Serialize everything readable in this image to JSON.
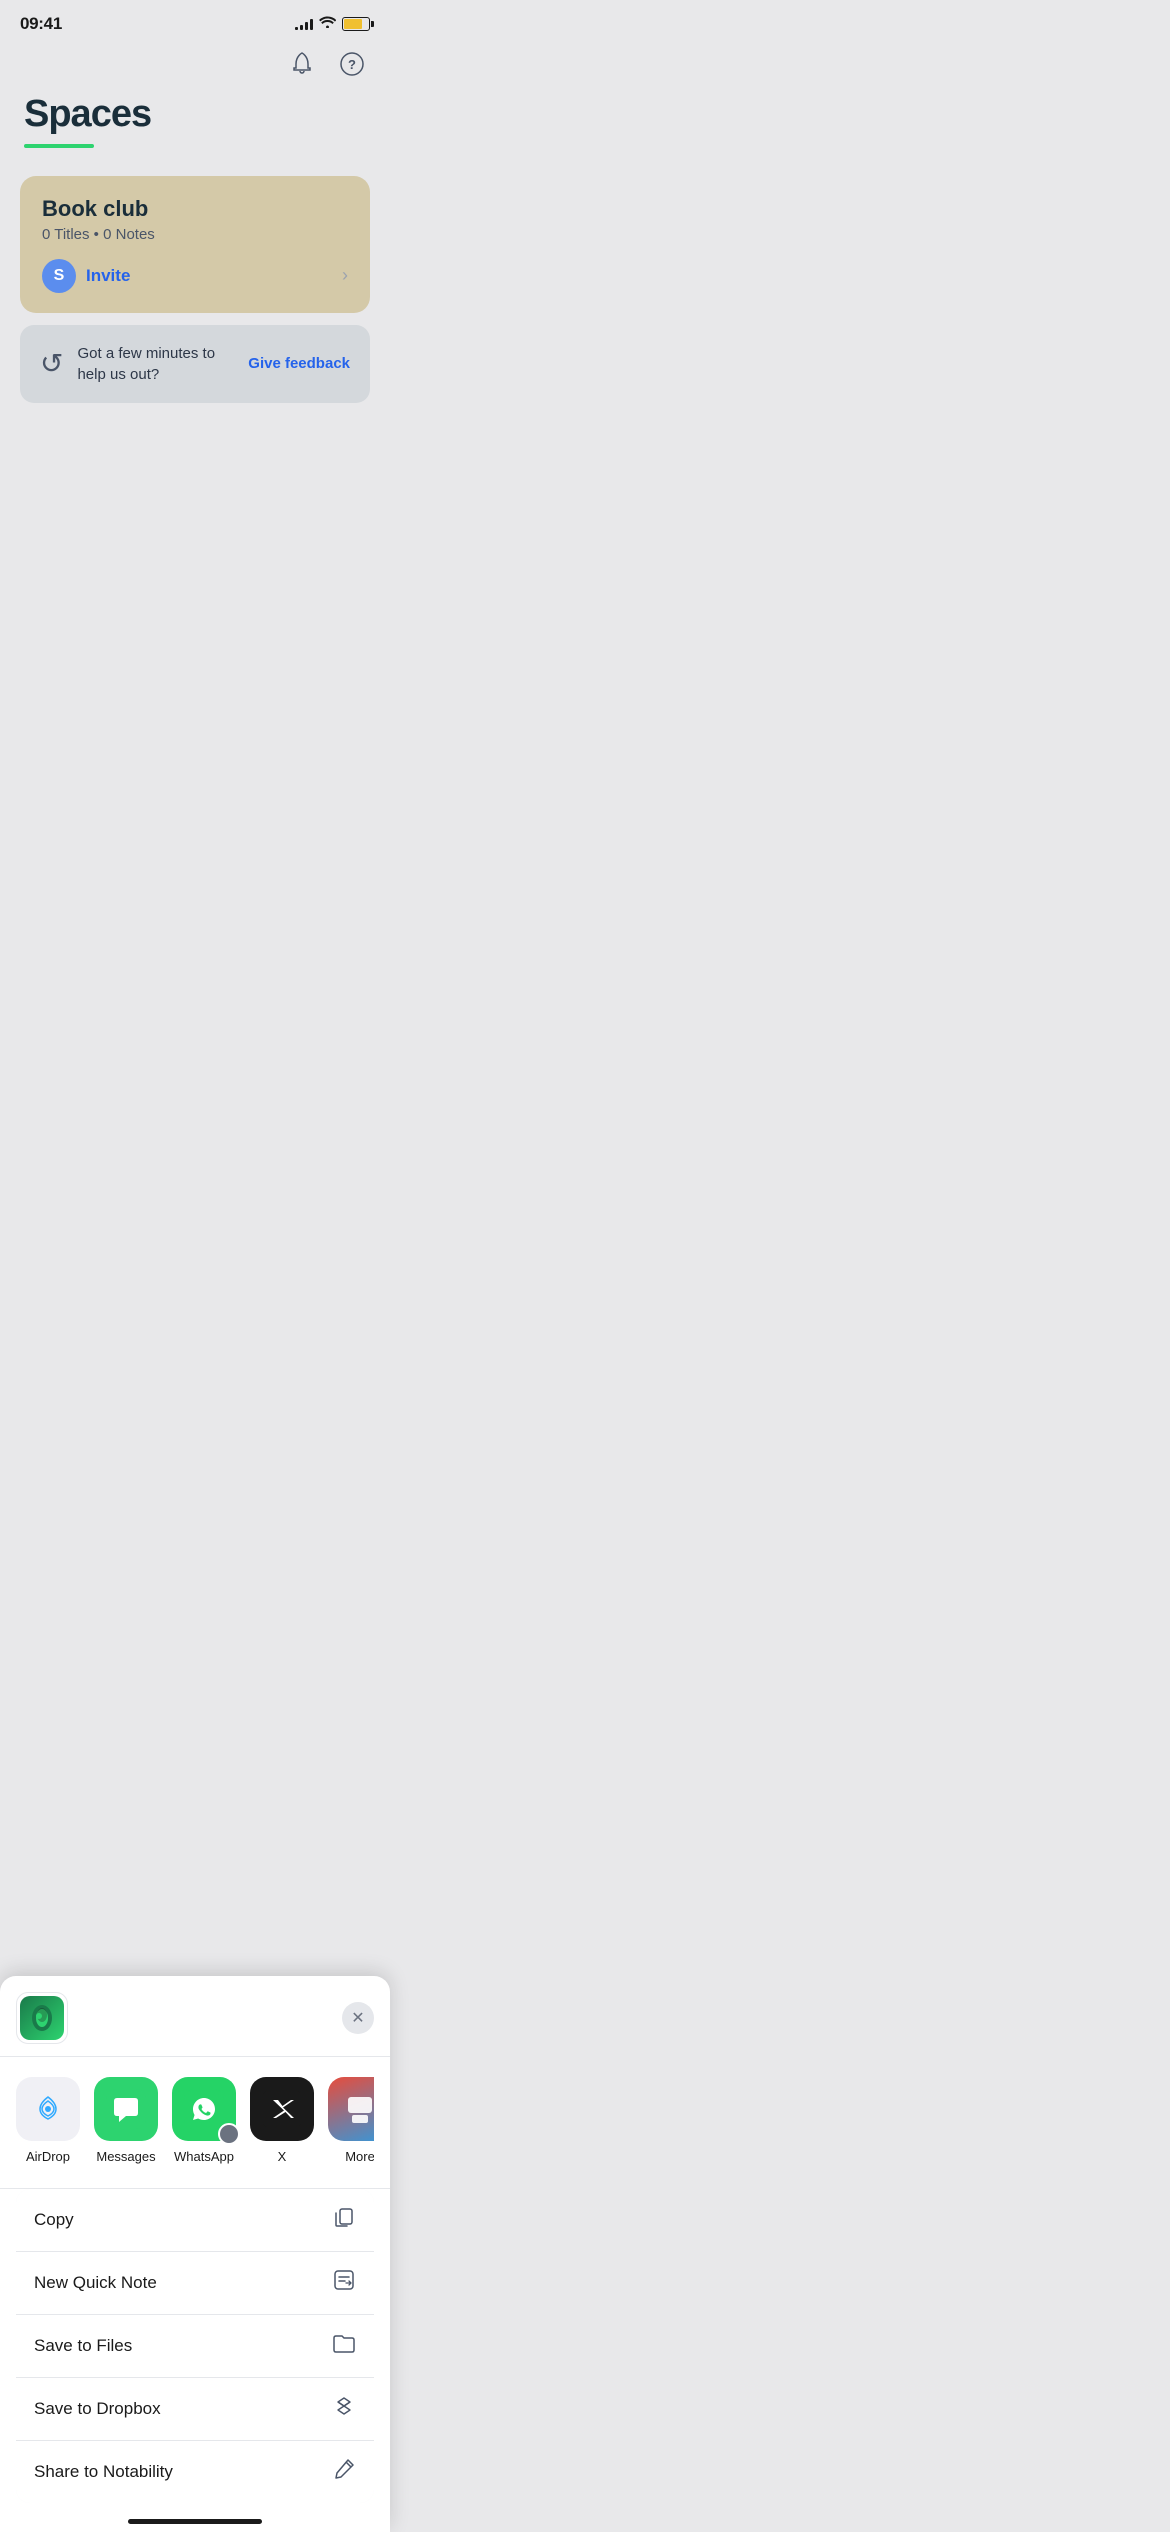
{
  "statusBar": {
    "time": "09:41",
    "signalBars": [
      3,
      5,
      7,
      9,
      11
    ],
    "batteryPercent": 75
  },
  "header": {
    "notificationIcon": "bell",
    "helpIcon": "question-circle",
    "title": "Spaces",
    "titleUnderlineColor": "#2dd36f"
  },
  "bookClub": {
    "title": "Book club",
    "meta": "0 Titles • 0 Notes",
    "avatarLabel": "S",
    "inviteLabel": "Invite"
  },
  "feedbackCard": {
    "text": "Got a few minutes to help us out?",
    "linkLabel": "Give feedback"
  },
  "shareSheet": {
    "closeLabel": "×",
    "apps": [
      {
        "name": "AirDrop",
        "type": "airdrop"
      },
      {
        "name": "Messages",
        "type": "messages"
      },
      {
        "name": "WhatsApp",
        "type": "whatsapp"
      },
      {
        "name": "X",
        "type": "x"
      },
      {
        "name": "More",
        "type": "more"
      }
    ],
    "actions": [
      {
        "label": "Copy",
        "icon": "copy"
      },
      {
        "label": "New Quick Note",
        "icon": "note"
      },
      {
        "label": "Save to Files",
        "icon": "folder"
      },
      {
        "label": "Save to Dropbox",
        "icon": "dropbox"
      },
      {
        "label": "Share to Notability",
        "icon": "pencil"
      }
    ]
  }
}
